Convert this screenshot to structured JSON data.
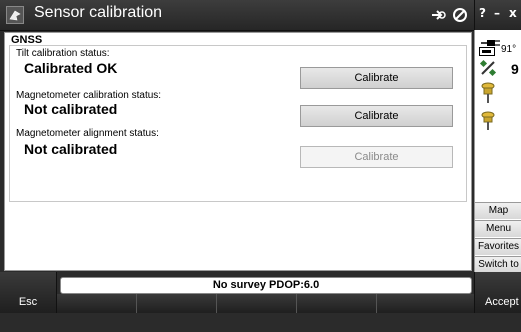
{
  "window": {
    "title": "Sensor calibration"
  },
  "title_bar_icons": {
    "app_icon": "instrument-icon",
    "connect_icon": "connect-arrow-icon",
    "disable_icon": "no-entry-icon"
  },
  "system_buttons": {
    "help": "?",
    "minimize": "–",
    "close": "x"
  },
  "main": {
    "section_title": "GNSS",
    "items": [
      {
        "label": "Tilt calibration status:",
        "value": "Calibrated OK",
        "button": "Calibrate",
        "button_enabled": true
      },
      {
        "label": "Magnetometer calibration status:",
        "value": "Not calibrated",
        "button": "Calibrate",
        "button_enabled": true
      },
      {
        "label": "Magnetometer alignment status:",
        "value": "Not calibrated",
        "button": "Calibrate",
        "button_enabled": false
      }
    ]
  },
  "sidebar": {
    "battery_value": "91°",
    "satellite_value": "9",
    "buttons": [
      "Map",
      "Menu",
      "Favorites",
      "Switch to"
    ]
  },
  "status_bar": {
    "text": "No survey  PDOP:6.0"
  },
  "softkeys": {
    "left": "Esc",
    "right": "Accept"
  }
}
